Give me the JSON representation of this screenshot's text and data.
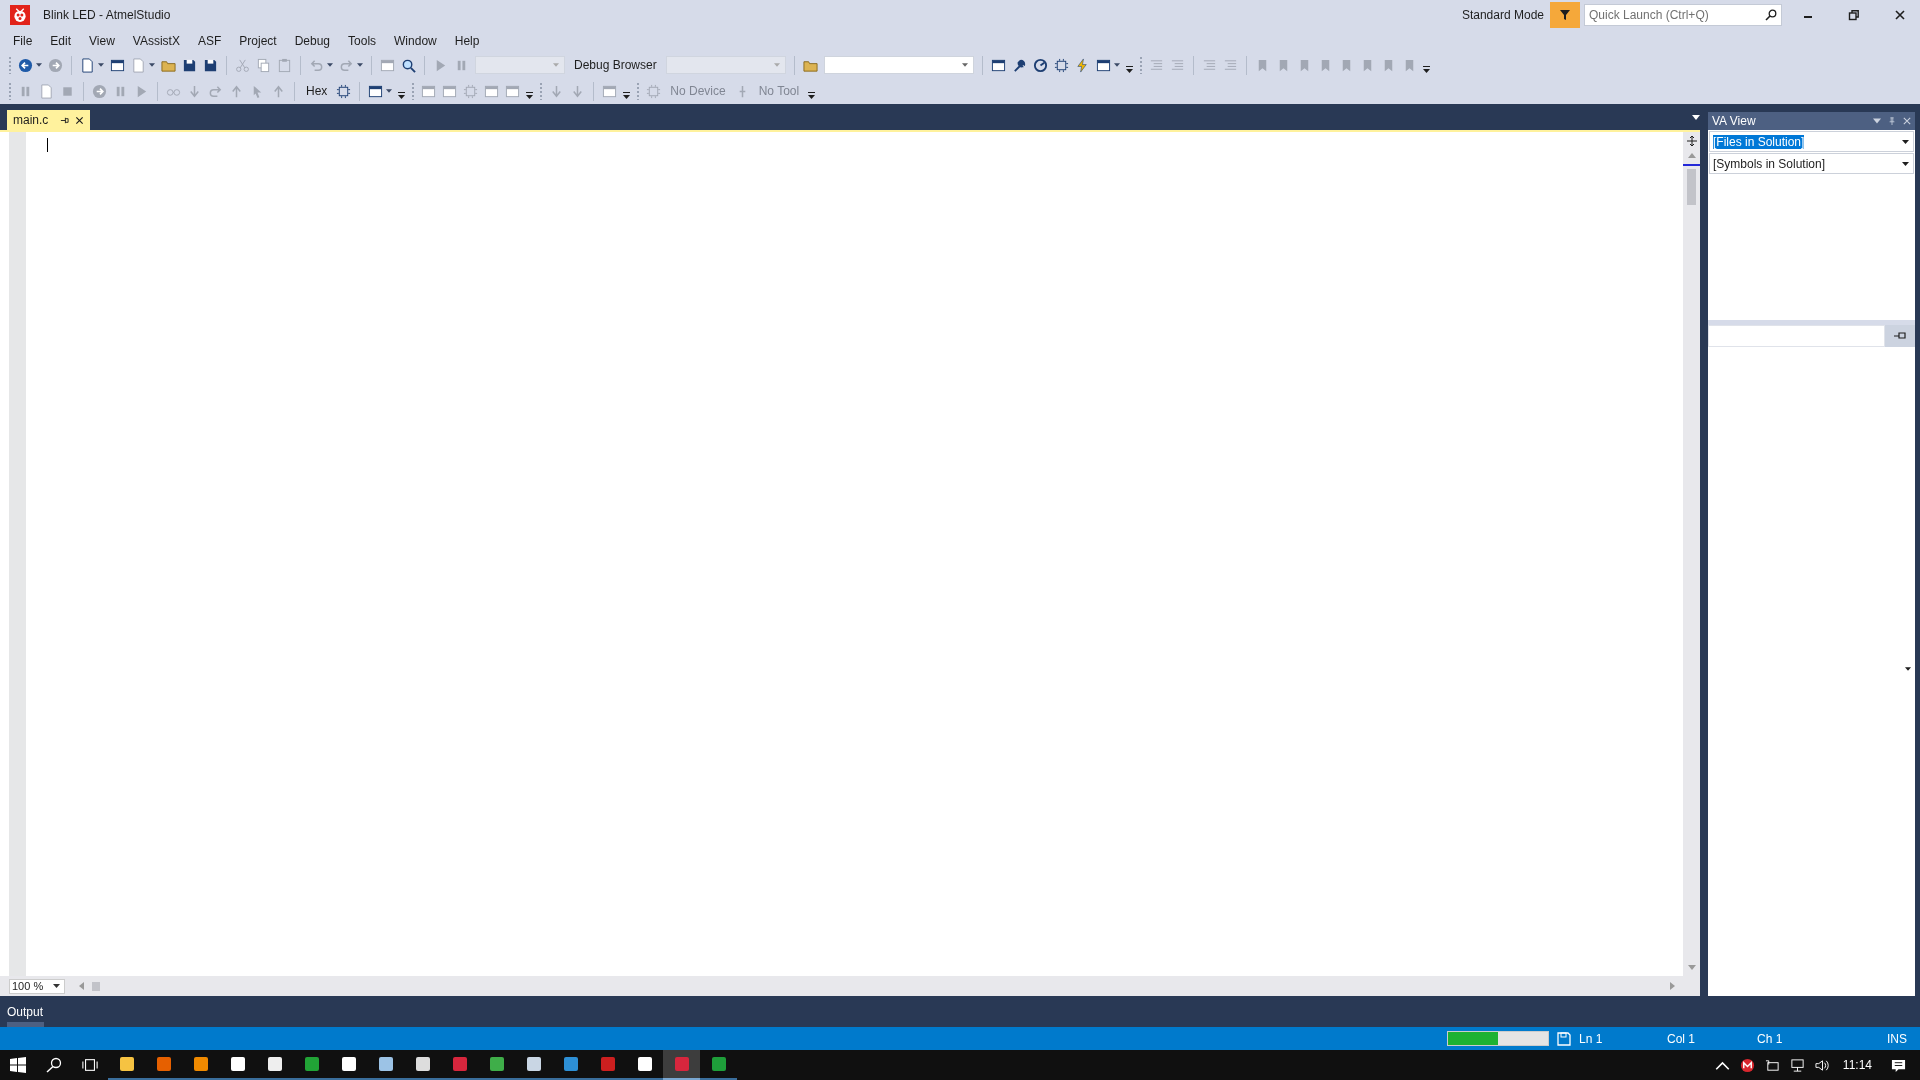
{
  "window": {
    "title": "Blink LED - AtmelStudio",
    "mode": "Standard Mode",
    "quick_launch": {
      "placeholder": "Quick Launch (Ctrl+Q)"
    }
  },
  "menu": [
    "File",
    "Edit",
    "View",
    "VAssistX",
    "ASF",
    "Project",
    "Debug",
    "Tools",
    "Window",
    "Help"
  ],
  "toolbar_1": {
    "buttons": [
      {
        "disabled": false
      },
      {
        "disabled": true
      },
      {
        "disabled": false
      },
      {
        "disabled": false
      },
      {
        "disabled": true
      },
      {
        "disabled": false
      },
      {
        "disabled": false
      },
      {
        "disabled": false
      },
      {
        "disabled": true
      },
      {
        "disabled": true
      },
      {
        "disabled": true
      },
      {
        "disabled": true
      },
      {
        "disabled": true
      },
      {
        "disabled": true
      },
      {
        "disabled": false
      },
      {
        "disabled": true
      },
      {
        "disabled": true
      },
      {
        "disabled": false
      },
      {
        "disabled": false
      },
      {
        "disabled": false
      },
      {
        "disabled": false
      },
      {
        "disabled": false
      },
      {
        "disabled": false
      },
      {
        "disabled": false
      },
      {
        "disabled": true
      },
      {
        "disabled": true
      },
      {
        "disabled": true
      },
      {
        "disabled": true
      },
      {
        "disabled": true
      },
      {
        "disabled": true
      },
      {
        "disabled": true
      },
      {
        "disabled": true
      },
      {
        "disabled": true
      },
      {
        "disabled": true
      },
      {
        "disabled": true
      },
      {
        "disabled": true
      }
    ],
    "combos": [
      {
        "disabled": true
      },
      {
        "disabled": true
      },
      {
        "disabled": false
      }
    ],
    "labels": [
      {
        "text": "Debug Browser",
        "disabled": false
      }
    ]
  },
  "toolbar_2": {
    "buttons": [
      {
        "disabled": true
      },
      {
        "disabled": true
      },
      {
        "disabled": true
      },
      {
        "disabled": true
      },
      {
        "disabled": true
      },
      {
        "disabled": true
      },
      {
        "disabled": true
      },
      {
        "disabled": true
      },
      {
        "disabled": true
      },
      {
        "disabled": true
      },
      {
        "disabled": true
      },
      {
        "disabled": true
      },
      {
        "disabled": false
      },
      {
        "disabled": false
      },
      {
        "disabled": true
      },
      {
        "disabled": true
      },
      {
        "disabled": true
      },
      {
        "disabled": true
      },
      {
        "disabled": true
      },
      {
        "disabled": true
      },
      {
        "disabled": true
      },
      {
        "disabled": true
      }
    ],
    "labels": [
      {
        "text": "Hex",
        "disabled": false
      },
      {
        "text": "No Device",
        "disabled": true
      },
      {
        "text": "No Tool",
        "disabled": true
      }
    ]
  },
  "tabs": [
    {
      "label": "main.c",
      "selected": true
    }
  ],
  "editor": {
    "zoom": "100 %"
  },
  "va_view": {
    "title": "VA View",
    "dropdowns": [
      {
        "value": "[Files in Solution]",
        "selected": true
      },
      {
        "value": "[Symbols in Solution]",
        "selected": false
      }
    ]
  },
  "output": {
    "title": "Output"
  },
  "status_bar": {
    "progress": {
      "level": 0.5
    },
    "line": "Ln 1",
    "column": "Col 1",
    "char": "Ch 1",
    "mode": "INS"
  },
  "taskbar": {
    "apps": [
      {
        "selected": false
      },
      {
        "selected": false
      },
      {
        "selected": false
      },
      {
        "selected": false
      },
      {
        "selected": false
      },
      {
        "selected": false
      },
      {
        "selected": false
      },
      {
        "selected": false
      },
      {
        "selected": false
      },
      {
        "selected": false
      },
      {
        "selected": false
      },
      {
        "selected": false
      },
      {
        "selected": false
      },
      {
        "selected": false
      },
      {
        "selected": false
      },
      {
        "selected": true
      },
      {
        "selected": false
      }
    ],
    "time": "11:14"
  }
}
